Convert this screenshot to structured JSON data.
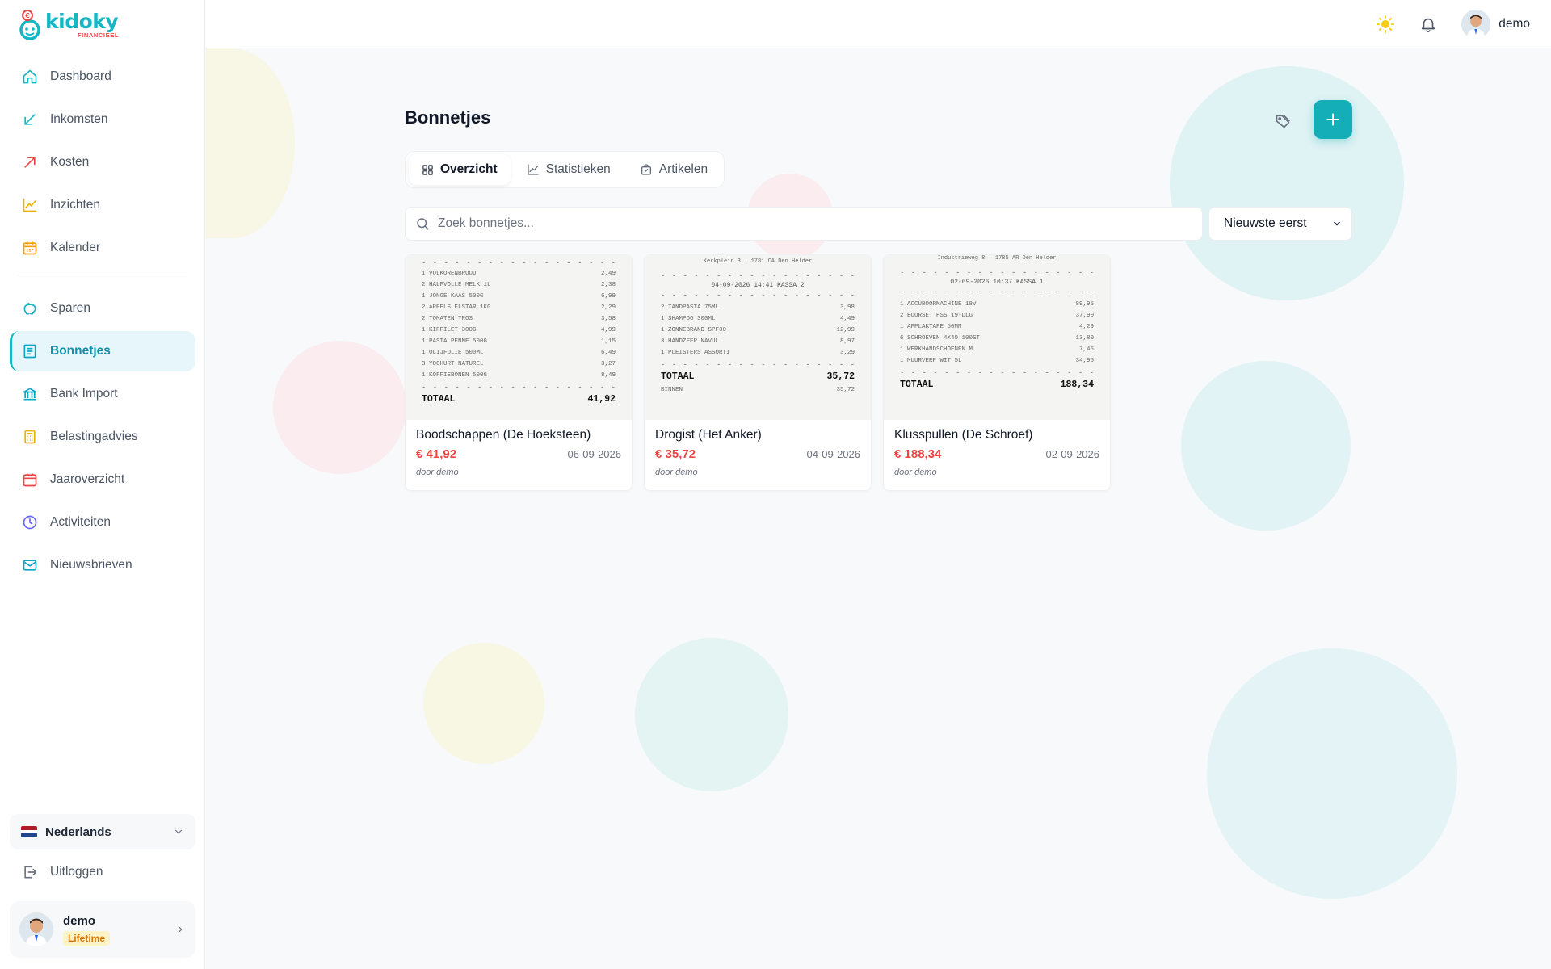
{
  "brand": {
    "name": "kidoky",
    "sub": "FINANCIEEL",
    "coin": "€"
  },
  "colors": {
    "accent": "#14b8c4",
    "button": "#13aeb7",
    "amount": "#ef4444",
    "activeBg": "#e6f6fb",
    "badgeBg": "#fef3c7",
    "badgeText": "#d97706"
  },
  "sidebar": {
    "items": [
      {
        "label": "Dashboard",
        "icon": "home-icon"
      },
      {
        "label": "Inkomsten",
        "icon": "arrow-down-left-icon"
      },
      {
        "label": "Kosten",
        "icon": "arrow-up-right-icon"
      },
      {
        "label": "Inzichten",
        "icon": "chart-line-icon"
      },
      {
        "label": "Kalender",
        "icon": "calendar-icon"
      },
      {
        "label": "Sparen",
        "icon": "piggy-bank-icon"
      },
      {
        "label": "Bonnetjes",
        "icon": "receipt-icon",
        "active": true
      },
      {
        "label": "Bank Import",
        "icon": "bank-icon"
      },
      {
        "label": "Belastingadvies",
        "icon": "calculator-icon"
      },
      {
        "label": "Jaaroverzicht",
        "icon": "calendar-year-icon"
      },
      {
        "label": "Activiteiten",
        "icon": "clock-icon"
      },
      {
        "label": "Nieuwsbrieven",
        "icon": "mail-icon"
      }
    ],
    "language": "Nederlands",
    "logout": "Uitloggen",
    "user": {
      "name": "demo",
      "plan": "Lifetime"
    }
  },
  "topbar": {
    "user": "demo"
  },
  "page": {
    "title": "Bonnetjes",
    "tabs": [
      {
        "label": "Overzicht",
        "icon": "grid-icon",
        "active": true
      },
      {
        "label": "Statistieken",
        "icon": "chart-icon"
      },
      {
        "label": "Artikelen",
        "icon": "bag-icon"
      }
    ],
    "search_placeholder": "Zoek bonnetjes...",
    "sort_selected": "Nieuwste eerst"
  },
  "receipts": [
    {
      "title": "Boodschappen (De Hoeksteen)",
      "amount": "€ 41,92",
      "date": "06-09-2026",
      "by": "door demo",
      "lines": [
        [
          "1 VOLKORENBROOD",
          "2,49"
        ],
        [
          "2 HALFVOLLE MELK 1L",
          "2,38"
        ],
        [
          "1 JONGE KAAS 500G",
          "6,99"
        ],
        [
          "2 APPELS ELSTAR 1KG",
          "2,29"
        ],
        [
          "2 TOMATEN TROS",
          "3,58"
        ],
        [
          "1 KIPFILET 300G",
          "4,99"
        ],
        [
          "1 PASTA PENNE 500G",
          "1,15"
        ],
        [
          "1 OLIJFOLIE 500ML",
          "6,49"
        ],
        [
          "3 YOGHURT NATUREL",
          "3,27"
        ],
        [
          "1 KOFFIEBONEN 500G",
          "8,49"
        ]
      ],
      "total": "41,92"
    },
    {
      "title": "Drogist (Het Anker)",
      "amount": "€ 35,72",
      "date": "04-09-2026",
      "by": "door demo",
      "header": "Kerkplein 3 · 1781 CA Den Helder",
      "meta": "04-09-2026 14:41 KASSA 2",
      "lines": [
        [
          "2 TANDPASTA 75ML",
          "3,98"
        ],
        [
          "1 SHAMPOO 300ML",
          "4,49"
        ],
        [
          "1 ZONNEBRAND SPF30",
          "12,99"
        ],
        [
          "3 HANDZEEP NAVUL",
          "8,97"
        ],
        [
          "1 PLEISTERS ASSORTI",
          "3,29"
        ]
      ],
      "total": "35,72",
      "after": [
        "BINNEN",
        "35,72"
      ]
    },
    {
      "title": "Klusspullen (De Schroef)",
      "amount": "€ 188,34",
      "date": "02-09-2026",
      "by": "door demo",
      "header": "Industrieweg 8 · 1785 AR Den Helder",
      "meta": "02-09-2026 10:37 KASSA 1",
      "lines": [
        [
          "1 ACCUBOORMACHINE 18V",
          "89,95"
        ],
        [
          "2 BOORSET HSS 19-DLG",
          "37,90"
        ],
        [
          "1 AFPLAKTAPE 50MM",
          "4,29"
        ],
        [
          "6 SCHROEVEN 4X40 100ST",
          "13,80"
        ],
        [
          "1 WERKHANDSCHOENEN M",
          "7,45"
        ],
        [
          "1 MUURVERF WIT 5L",
          "34,95"
        ]
      ],
      "total": "188,34"
    }
  ]
}
